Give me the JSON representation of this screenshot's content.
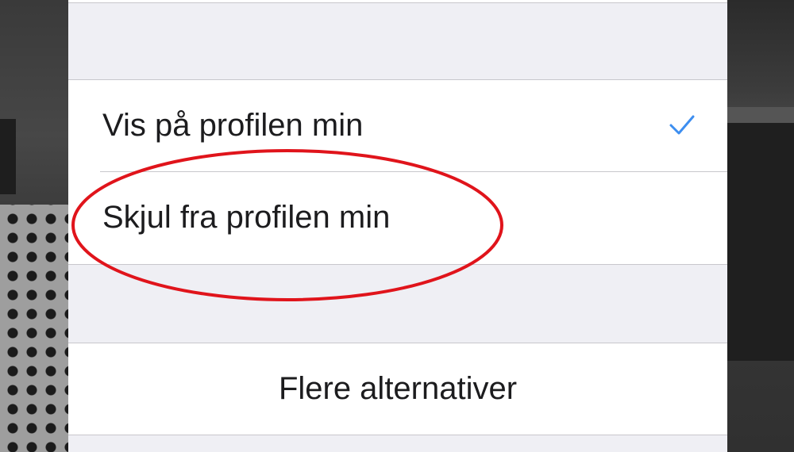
{
  "sheet": {
    "options": [
      {
        "label": "Vis på profilen min",
        "selected": true
      },
      {
        "label": "Skjul fra profilen min",
        "selected": false
      }
    ],
    "more_label": "Flere alternativer"
  },
  "icons": {
    "checkmark": "checkmark-icon"
  },
  "colors": {
    "checkmark": "#3d8ef0",
    "annotation": "#e0141b",
    "sheet_background": "#efeff4",
    "row_background": "#ffffff",
    "separator": "#c8c7cc"
  }
}
